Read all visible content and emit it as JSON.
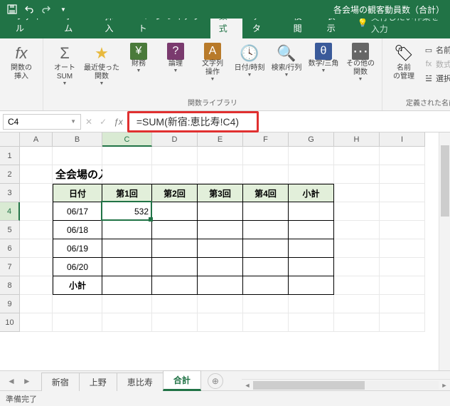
{
  "titlebar": {
    "title": "各会場の観客動員数（合計）"
  },
  "tabs": {
    "file": "ファイル",
    "home": "ホーム",
    "insert": "挿入",
    "layout": "ページ レイアウト",
    "formulas": "数式",
    "data": "データ",
    "review": "校閲",
    "view": "表示",
    "tellme": "実行したい作業を入力"
  },
  "ribbon": {
    "insert_fn": "関数の\n挿入",
    "autosum": "オート\nSUM",
    "recent": "最近使った\n関数",
    "financial": "財務",
    "logical": "論理",
    "text": "文字列\n操作",
    "datetime": "日付/時刻",
    "lookup": "検索/行列",
    "math": "数学/三角",
    "more": "その他の\n関数",
    "group1_label": "関数ライブラリ",
    "name_mgr": "名前\nの管理",
    "define_name": "名前の定義",
    "use_in_formula": "数式で使用",
    "create_from_sel": "選択範囲か",
    "group2_label": "定義された名前"
  },
  "icons": {
    "fx_large": "fx",
    "sigma": "Σ",
    "star": "★",
    "yen": "¥",
    "question": "?",
    "A_icon": "A",
    "clock": "🕓",
    "search": "🔍",
    "theta": "θ",
    "dots": "⋯",
    "tag": "🏷"
  },
  "formula": {
    "namebox": "C4",
    "value": "=SUM(新宿:恵比寿!C4)"
  },
  "columns": [
    "A",
    "B",
    "C",
    "D",
    "E",
    "F",
    "G",
    "H",
    "I"
  ],
  "rows": [
    "1",
    "2",
    "3",
    "4",
    "5",
    "6",
    "7",
    "8",
    "9",
    "10"
  ],
  "table": {
    "title": "全会場の入場者数の合計",
    "headers": {
      "date": "日付",
      "r1": "第1回",
      "r2": "第2回",
      "r3": "第3回",
      "r4": "第4回",
      "subtotal": "小計"
    },
    "dates": [
      "06/17",
      "06/18",
      "06/19",
      "06/20"
    ],
    "subtotal_row": "小計",
    "value_c4": "532"
  },
  "sheets": {
    "s1": "新宿",
    "s2": "上野",
    "s3": "恵比寿",
    "s4": "合計"
  },
  "statusbar": {
    "ready": "準備完了"
  }
}
